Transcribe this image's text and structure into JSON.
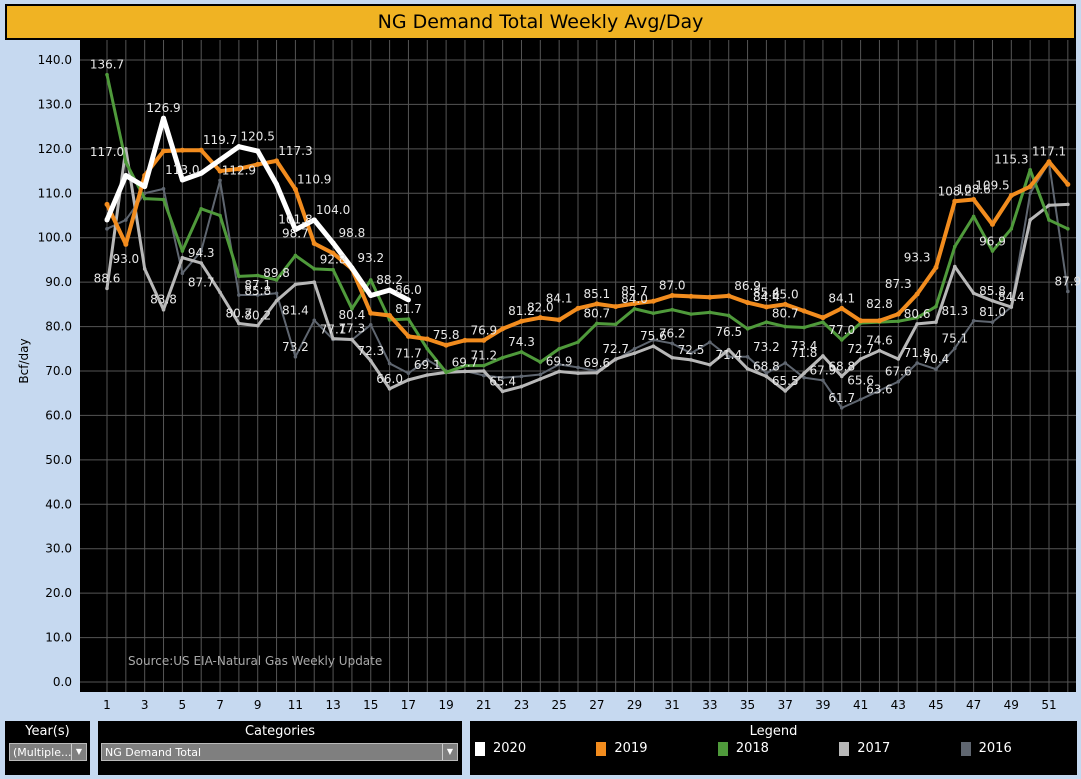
{
  "title": "NG Demand Total Weekly Avg/Day",
  "source_note": "Source:US EIA-Natural Gas Weekly Update",
  "filters": {
    "years_label": "Year(s)",
    "years_value": "(Multiple...",
    "categories_label": "Categories",
    "categories_value": "NG Demand Total"
  },
  "legend": {
    "title": "Legend"
  },
  "chart_data": {
    "type": "line",
    "title": "NG Demand Total Weekly Avg/Day",
    "xlabel": "",
    "ylabel": "Bcf/day",
    "ylim": [
      0,
      140
    ],
    "yticks": [
      "0.0",
      "10.0",
      "20.0",
      "30.0",
      "40.0",
      "50.0",
      "60.0",
      "70.0",
      "80.0",
      "90.0",
      "100.0",
      "110.0",
      "120.0",
      "130.0",
      "140.0"
    ],
    "xticks": [
      "1",
      "3",
      "5",
      "7",
      "9",
      "11",
      "13",
      "15",
      "17",
      "19",
      "21",
      "23",
      "25",
      "27",
      "29",
      "31",
      "33",
      "35",
      "37",
      "39",
      "41",
      "43",
      "45",
      "47",
      "49",
      "51"
    ],
    "x_weeks": 52,
    "grid": true,
    "legend_position": "bottom",
    "series": [
      {
        "name": "2016",
        "color": "#5f6670",
        "width": 2,
        "values": [
          102,
          104,
          110,
          111,
          92,
          97,
          112.9,
          87.1,
          87.1,
          87.5,
          73.2,
          81.4,
          77.1,
          77,
          80.4,
          71.7,
          69.5,
          72.5,
          70,
          70,
          69,
          68.5,
          68.8,
          69.2,
          71.5,
          70.8,
          70,
          72.5,
          75,
          77,
          76.2,
          74,
          76.5,
          73.2,
          73.2,
          69.5,
          71.8,
          68.5,
          67.9,
          61.7,
          63.6,
          65.6,
          67.6,
          71.8,
          70.4,
          75.1,
          81.3,
          81.0,
          84.4,
          110,
          117,
          87.9
        ]
      },
      {
        "name": "2017",
        "color": "#b8b8b8",
        "width": 3,
        "values": [
          88.6,
          120,
          93.0,
          83.8,
          95.5,
          94.3,
          87.7,
          80.7,
          80.2,
          85.8,
          89.5,
          90,
          77.3,
          77.1,
          72.3,
          66.0,
          68,
          69.1,
          69.7,
          69.9,
          70,
          65.4,
          66.5,
          68.2,
          69.9,
          69.5,
          69.6,
          72.7,
          74,
          75.6,
          73,
          72.5,
          71.4,
          74.8,
          70.5,
          68.8,
          65.5,
          69.5,
          73.4,
          68.8,
          72.7,
          74.6,
          72.7,
          80.6,
          81,
          93.5,
          87.5,
          85.8,
          84.4,
          104,
          107.3,
          107.5
        ]
      },
      {
        "name": "2018",
        "color": "#4f9a3b",
        "width": 3,
        "values": [
          136.7,
          117,
          108.8,
          108.6,
          97,
          106.5,
          105,
          91.3,
          91.5,
          90.5,
          96,
          93,
          92.8,
          84,
          90.5,
          81.5,
          81.7,
          75,
          69.7,
          71.2,
          71.2,
          73,
          74.3,
          72,
          75,
          76.5,
          80.7,
          80.5,
          84.0,
          83,
          83.8,
          82.8,
          83.2,
          82.5,
          79.5,
          81,
          80,
          79.8,
          81,
          77.0,
          80.8,
          81,
          81.2,
          82,
          84.5,
          98,
          104.8,
          97,
          102,
          115.3,
          104,
          102
        ]
      },
      {
        "name": "2019",
        "color": "#f28c1e",
        "width": 4,
        "values": [
          107.5,
          98.5,
          114,
          119.5,
          119.7,
          119.7,
          115,
          115.5,
          116.5,
          117.3,
          110.9,
          98.7,
          96.5,
          93,
          83,
          82.5,
          77.8,
          77.2,
          75.8,
          76.9,
          76.9,
          79.5,
          81.2,
          82.0,
          81.5,
          84.1,
          85.1,
          84.5,
          85.2,
          85.7,
          87.0,
          86.8,
          86.6,
          86.9,
          85.4,
          84.4,
          85.0,
          83.5,
          82,
          84.1,
          81.3,
          81.3,
          82.8,
          87.3,
          93.3,
          108.2,
          108.6,
          103,
          109.5,
          111.5,
          117.1,
          112
        ]
      },
      {
        "name": "2020",
        "color": "#ffffff",
        "width": 5,
        "values": [
          104,
          114,
          111.5,
          126.9,
          113,
          114.5,
          117.5,
          120.5,
          119.5,
          112,
          101.8,
          104,
          98.8,
          93.2,
          87,
          88.2,
          86.0
        ]
      }
    ],
    "data_labels": [
      [
        1,
        "136.7"
      ],
      [
        1,
        "117.0"
      ],
      [
        4,
        "126.9"
      ],
      [
        5,
        "113.0"
      ],
      [
        7,
        "119.7"
      ],
      [
        9,
        "120.5"
      ],
      [
        11,
        "117.3"
      ],
      [
        12,
        "110.9"
      ],
      [
        11,
        "101.8"
      ],
      [
        13,
        "104.0"
      ],
      [
        14,
        "98.8"
      ],
      [
        15,
        "93.2"
      ],
      [
        16,
        "88.2"
      ],
      [
        17,
        "86.0"
      ],
      [
        8,
        "112.9"
      ],
      [
        2,
        "93.0"
      ],
      [
        1,
        "88.6"
      ],
      [
        4,
        "83.8"
      ],
      [
        6,
        "94.3"
      ],
      [
        6,
        "87.7"
      ],
      [
        8,
        "80.7"
      ],
      [
        10,
        "89.8"
      ],
      [
        9,
        "87.1"
      ],
      [
        9,
        "85.8"
      ],
      [
        9,
        "80.2"
      ],
      [
        11,
        "98.7"
      ],
      [
        13,
        "92.8"
      ],
      [
        11,
        "81.4"
      ],
      [
        11,
        "73.2"
      ],
      [
        13,
        "77.1"
      ],
      [
        14,
        "77.3"
      ],
      [
        14,
        "80.4"
      ],
      [
        15,
        "72.3"
      ],
      [
        16,
        "66.0"
      ],
      [
        17,
        "71.7"
      ],
      [
        17,
        "81.7"
      ],
      [
        18,
        "69.1"
      ],
      [
        19,
        "75.8"
      ],
      [
        20,
        "69.7"
      ],
      [
        21,
        "71.2"
      ],
      [
        21,
        "76.9"
      ],
      [
        23,
        "81.2"
      ],
      [
        24,
        "82.0"
      ],
      [
        23,
        "74.3"
      ],
      [
        22,
        "65.4"
      ],
      [
        25,
        "84.1"
      ],
      [
        27,
        "85.1"
      ],
      [
        27,
        "80.7"
      ],
      [
        28,
        "72.7"
      ],
      [
        25,
        "69.9"
      ],
      [
        27,
        "69.6"
      ],
      [
        29,
        "85.7"
      ],
      [
        29,
        "84.0"
      ],
      [
        31,
        "87.0"
      ],
      [
        31,
        "76.2"
      ],
      [
        30,
        "75.6"
      ],
      [
        32,
        "72.5"
      ],
      [
        34,
        "76.5"
      ],
      [
        34,
        "71.4"
      ],
      [
        35,
        "86.9"
      ],
      [
        36,
        "85.4"
      ],
      [
        36,
        "84.4"
      ],
      [
        36,
        "73.2"
      ],
      [
        36,
        "68.8"
      ],
      [
        37,
        "85.0"
      ],
      [
        37,
        "80.7"
      ],
      [
        38,
        "73.4"
      ],
      [
        38,
        "71.8"
      ],
      [
        37,
        "65.5"
      ],
      [
        39,
        "67.9"
      ],
      [
        40,
        "84.1"
      ],
      [
        40,
        "77.0"
      ],
      [
        40,
        "68.8"
      ],
      [
        40,
        "61.7"
      ],
      [
        42,
        "82.8"
      ],
      [
        42,
        "74.6"
      ],
      [
        41,
        "72.7"
      ],
      [
        41,
        "65.6"
      ],
      [
        42,
        "63.6"
      ],
      [
        43,
        "87.3"
      ],
      [
        44,
        "93.3"
      ],
      [
        43,
        "67.6"
      ],
      [
        44,
        "71.8"
      ],
      [
        44,
        "80.6"
      ],
      [
        46,
        "108.2"
      ],
      [
        47,
        "108.6"
      ],
      [
        46,
        "81.3"
      ],
      [
        45,
        "70.4"
      ],
      [
        46,
        "75.1"
      ],
      [
        48,
        "109.5"
      ],
      [
        48,
        "96.9"
      ],
      [
        48,
        "85.8"
      ],
      [
        48,
        "81.0"
      ],
      [
        49,
        "84.4"
      ],
      [
        49,
        "115.3"
      ],
      [
        51,
        "117.1"
      ],
      [
        52,
        "87.9"
      ]
    ]
  }
}
